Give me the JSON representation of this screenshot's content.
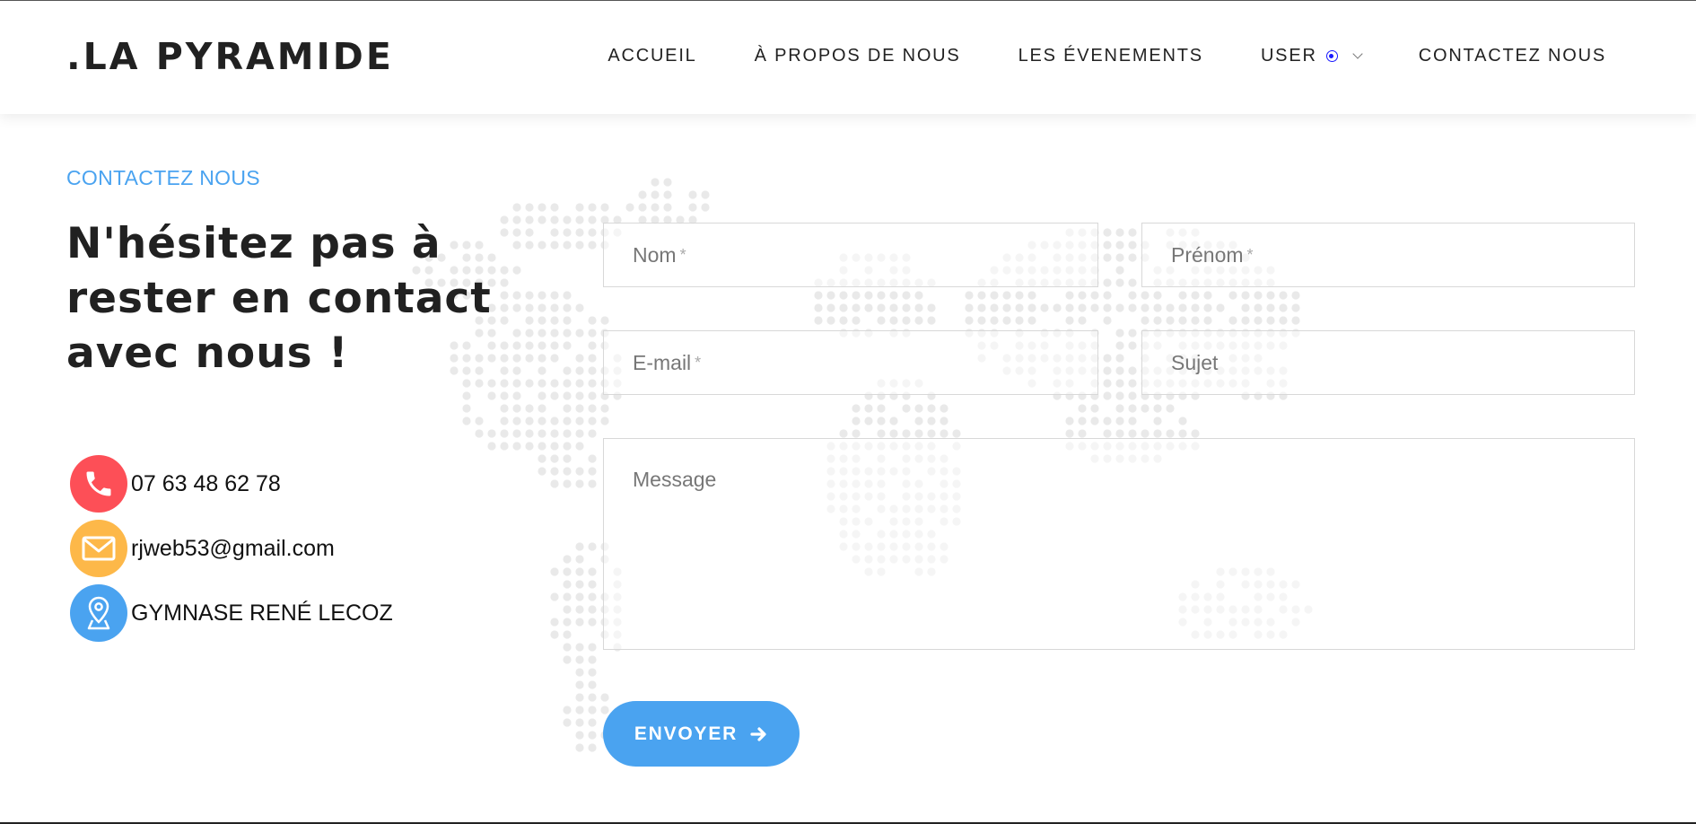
{
  "header": {
    "brand": ".LA PYRAMIDE",
    "nav": [
      {
        "label": "ACCUEIL"
      },
      {
        "label": "À PROPOS DE NOUS"
      },
      {
        "label": "LES ÉVENEMENTS"
      },
      {
        "label": "USER"
      },
      {
        "label": "CONTACTEZ NOUS"
      }
    ]
  },
  "contact": {
    "section_label": "CONTACTEZ NOUS",
    "heading_lines": [
      "N'hésitez pas à",
      "rester en contact",
      "avec nous !"
    ],
    "items": [
      {
        "icon": "phone-icon",
        "text": "07 63 48 62 78"
      },
      {
        "icon": "mail-icon",
        "text": "rjweb53@gmail.com"
      },
      {
        "icon": "location-icon",
        "text": "GYMNASE RENÉ LECOZ"
      }
    ]
  },
  "form": {
    "nom": {
      "placeholder": "Nom",
      "required_mark": "*"
    },
    "prenom": {
      "placeholder": "Prénom",
      "required_mark": "*"
    },
    "email": {
      "placeholder": "E-mail",
      "required_mark": "*"
    },
    "sujet": {
      "placeholder": "Sujet"
    },
    "message": {
      "placeholder": "Message"
    },
    "submit_label": "ENVOYER"
  },
  "colors": {
    "accent_blue": "#4aa3f0",
    "phone_red": "#fd4f57",
    "mail_yellow": "#fdb849",
    "text_dark": "#212121"
  }
}
